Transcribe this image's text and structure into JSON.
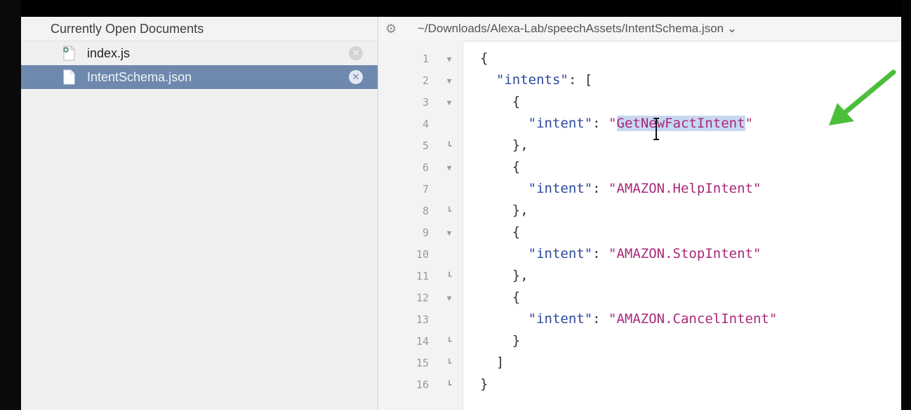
{
  "sidebar": {
    "header": "Currently Open Documents",
    "documents": [
      {
        "name": "index.js",
        "selected": false,
        "icon": "js-file-icon"
      },
      {
        "name": "IntentSchema.json",
        "selected": true,
        "icon": "json-file-icon"
      }
    ]
  },
  "editor": {
    "path": "~/Downloads/Alexa-Lab/speechAssets/IntentSchema.json ⌄",
    "line_numbers": [
      "1",
      "2",
      "3",
      "4",
      "5",
      "6",
      "7",
      "8",
      "9",
      "10",
      "11",
      "12",
      "13",
      "14",
      "15",
      "16"
    ],
    "code": {
      "l1": "{",
      "l2_key": "\"intents\"",
      "l2_rest": ": [",
      "l3": "{",
      "intent_key": "\"intent\"",
      "colon": ": ",
      "l4_q1": "\"",
      "l4_sel": "GetNewFactIntent",
      "l4_q2": "\"",
      "l5": "},",
      "l6": "{",
      "l7_val": "\"AMAZON.HelpIntent\"",
      "l8": "},",
      "l9": "{",
      "l10_val": "\"AMAZON.StopIntent\"",
      "l11": "},",
      "l12": "{",
      "l13_val": "\"AMAZON.CancelIntent\"",
      "l14": "}",
      "l15": "]",
      "l16": "}"
    }
  },
  "colors": {
    "selection": "#6e89ad",
    "string": "#a8297a",
    "key": "#2c4a9c",
    "highlight": "#c6d7f2",
    "arrow": "#4bbf3a"
  }
}
